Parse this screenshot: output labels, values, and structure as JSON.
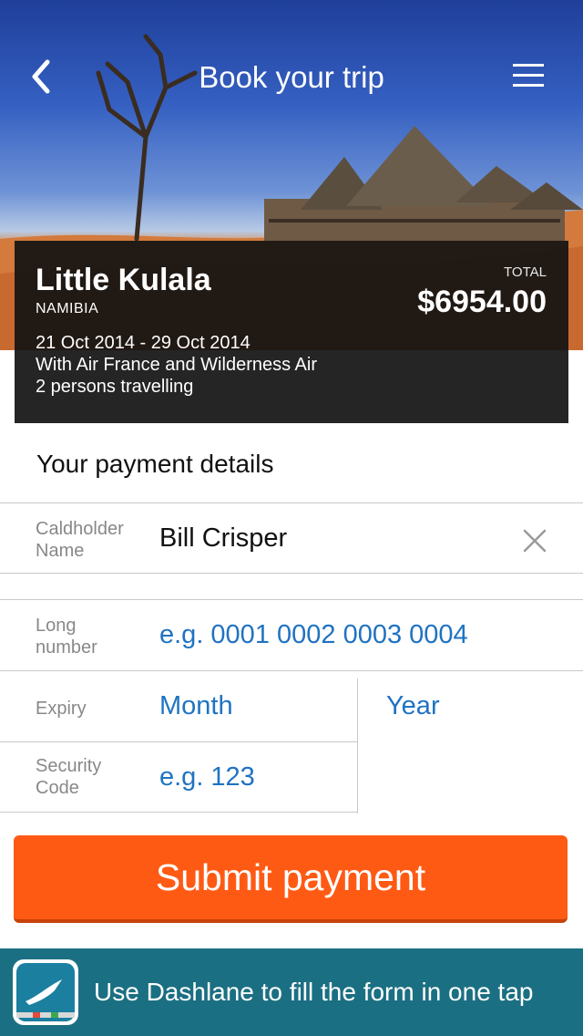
{
  "header": {
    "title": "Book your trip",
    "back_icon": "chevron-left-icon",
    "menu_icon": "hamburger-menu-icon"
  },
  "trip": {
    "name": "Little Kulala",
    "country": "NAMIBIA",
    "total_label": "TOTAL",
    "total_amount": "$6954.00",
    "dates": "21 Oct 2014 - 29 Oct 2014",
    "airlines": "With Air France and Wilderness Air",
    "travellers": "2 persons travelling"
  },
  "payment": {
    "section_title": "Your payment details",
    "cardholder": {
      "label_line1": "Caldholder",
      "label_line2": "Name",
      "value": "Bill Crisper"
    },
    "long_number": {
      "label_line1": "Long",
      "label_line2": "number",
      "placeholder": "e.g. 0001 0002 0003 0004"
    },
    "expiry": {
      "label": "Expiry",
      "month_placeholder": "Month",
      "year_placeholder": "Year"
    },
    "security": {
      "label_line1": "Security",
      "label_line2": "Code",
      "placeholder": "e.g. 123"
    }
  },
  "submit_label": "Submit payment",
  "dashlane": {
    "text": "Use Dashlane to fill the form in one tap",
    "icon": "dashlane-logo-icon"
  },
  "colors": {
    "accent": "#ff5a14",
    "link_blue": "#1f73c2",
    "dashlane_bar": "#1b6f82"
  }
}
